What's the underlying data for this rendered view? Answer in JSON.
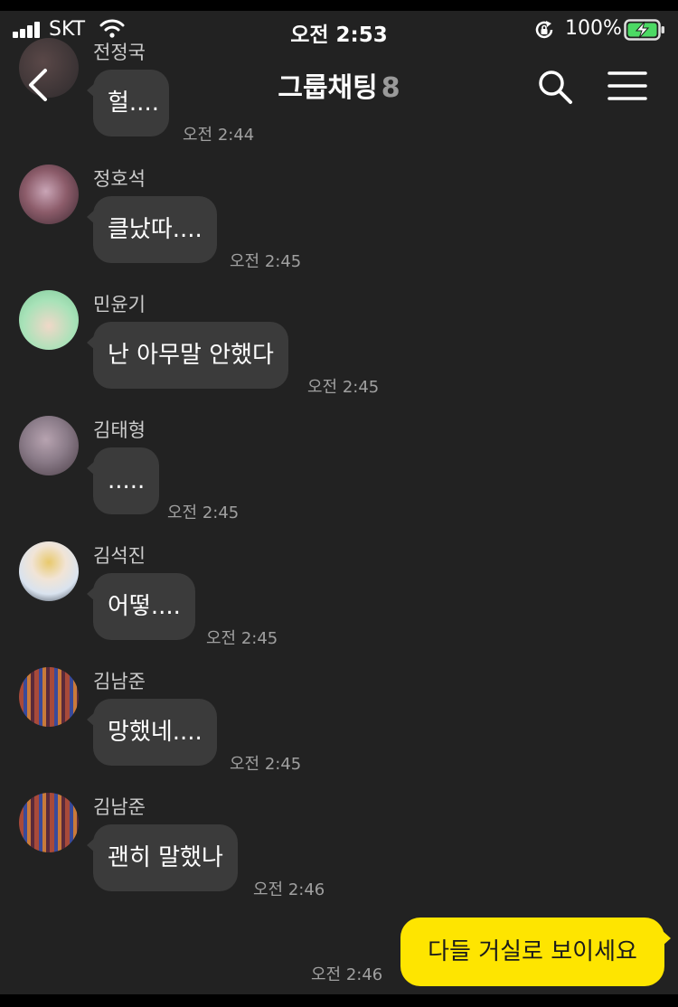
{
  "status_bar": {
    "carrier": "SKT",
    "time": "오전 2:53",
    "battery": "100%"
  },
  "header": {
    "title": "그룹채팅",
    "member_count": "8"
  },
  "messages": [
    {
      "sender": "전정국",
      "text": "헐....",
      "time": "오전 2:44",
      "avatar_colors": [
        "#5a4848",
        "#2d2a2c"
      ]
    },
    {
      "sender": "정호석",
      "text": "클났따....",
      "time": "오전 2:45",
      "avatar_colors": [
        "#c9a5b6",
        "#3a2730"
      ]
    },
    {
      "sender": "민윤기",
      "text": "난 아무말 안했다",
      "time": "오전 2:45",
      "avatar_colors": [
        "#a8e2b8",
        "#f0d8c8"
      ]
    },
    {
      "sender": "김태형",
      "text": ".....",
      "time": "오전 2:45",
      "avatar_colors": [
        "#8a7b88",
        "#4a3d46"
      ]
    },
    {
      "sender": "김석진",
      "text": "어떻....",
      "time": "오전 2:45",
      "avatar_colors": [
        "#d9e3ef",
        "#e8c96c"
      ]
    },
    {
      "sender": "김남준",
      "text": "망했네....",
      "time": "오전 2:45",
      "avatar_colors": [
        "#a84a3a",
        "#3a4a9a"
      ]
    },
    {
      "sender": "김남준",
      "text": "괜히 말했나",
      "time": "오전 2:46",
      "avatar_colors": [
        "#a84a3a",
        "#3a4a9a"
      ]
    }
  ],
  "my_message": {
    "text": "다들 거실로 보이세요",
    "time": "오전 2:46",
    "bubble_color": "#fee500"
  },
  "icons": [
    "signal-icon",
    "wifi-icon",
    "rotation-lock-icon",
    "battery-charging-icon",
    "back-arrow-icon",
    "search-icon",
    "menu-icon"
  ]
}
